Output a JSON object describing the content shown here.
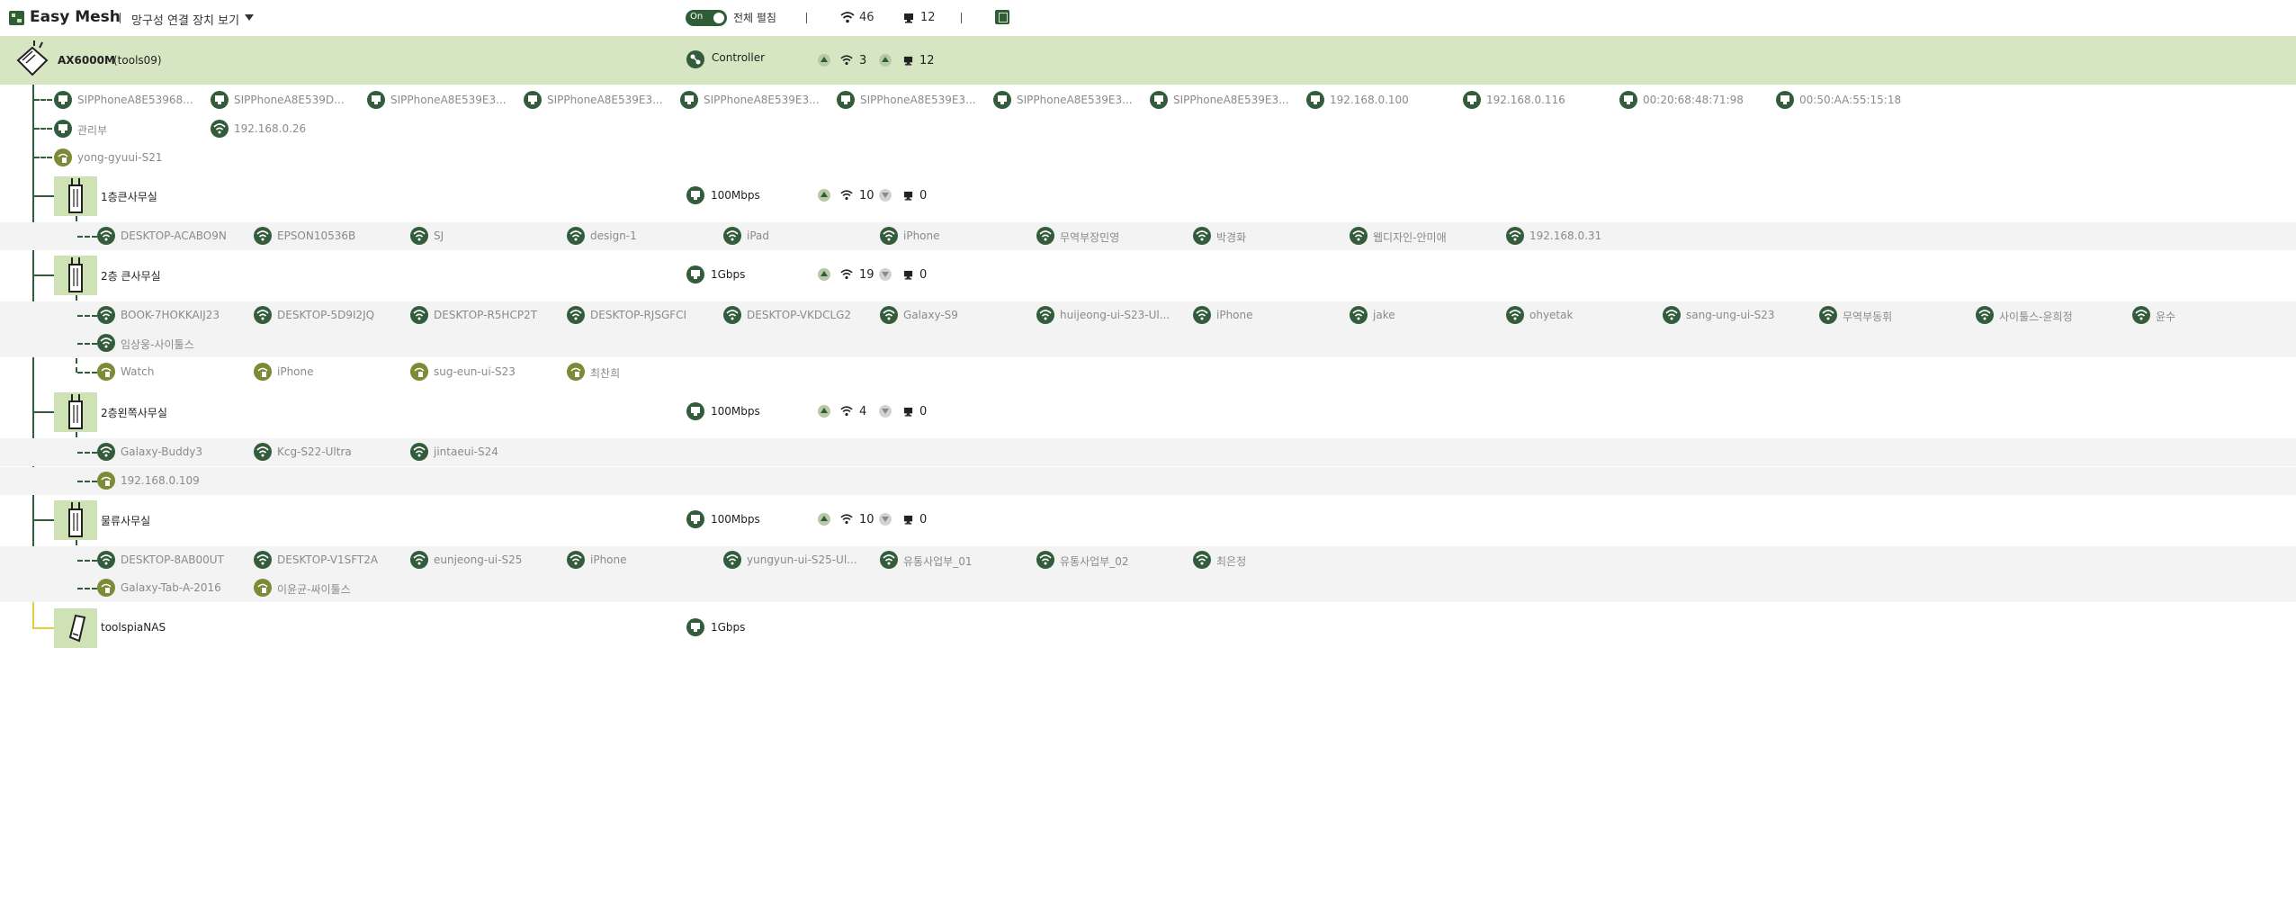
{
  "header": {
    "title": "Easy Mesh",
    "view_menu": "망구성 연결 장치 보기",
    "toggle_state": "On",
    "expand_all": "전체 펼침",
    "wifi_total": "46",
    "wired_total": "12"
  },
  "controller": {
    "name": "AX6000M",
    "name_suffix": "(tools09)",
    "role": "Controller",
    "wifi_count": "3",
    "wired_count": "12"
  },
  "controller_devices": {
    "row1": [
      "SIPPhoneA8E53968...",
      "SIPPhoneA8E539D...",
      "SIPPhoneA8E539E3...",
      "SIPPhoneA8E539E3...",
      "SIPPhoneA8E539E3...",
      "SIPPhoneA8E539E3...",
      "SIPPhoneA8E539E3...",
      "SIPPhoneA8E539E3...",
      "192.168.0.100",
      "192.168.0.116",
      "00:20:68:48:71:98",
      "00:50:AA:55:15:18"
    ],
    "row2": [
      "관리부",
      "192.168.0.26"
    ],
    "row3": [
      "yong-gyuui-S21"
    ]
  },
  "nodes": [
    {
      "name": "1층큰사무실",
      "speed": "100Mbps",
      "wifi": "10",
      "wired": "0",
      "wifi_devices": [
        "DESKTOP-ACABO9N",
        "EPSON10536B",
        "SJ",
        "design-1",
        "iPad",
        "iPhone",
        "무역부장민영",
        "박경화",
        "웹디자인-안미애",
        "192.168.0.31"
      ]
    },
    {
      "name": "2층 큰사무실",
      "speed": "1Gbps",
      "wifi": "19",
      "wired": "0",
      "wifi_devices": [
        "BOOK-7HOKKAIJ23",
        "DESKTOP-5D9I2JQ",
        "DESKTOP-R5HCP2T",
        "DESKTOP-RJSGFCI",
        "DESKTOP-VKDCLG2",
        "Galaxy-S9",
        "huijeong-ui-S23-Ul...",
        "iPhone",
        "jake",
        "ohyetak",
        "sang-ung-ui-S23",
        "무역부동휘",
        "사이툴스-윤희정",
        "윤수"
      ],
      "wifi_devices_2": [
        "임상웅-사이툴스"
      ],
      "mobile_devices": [
        "Watch",
        "iPhone",
        "sug-eun-ui-S23",
        "최찬희"
      ]
    },
    {
      "name": "2층왼쪽사무실",
      "speed": "100Mbps",
      "wifi": "4",
      "wired": "0",
      "wifi_devices": [
        "Galaxy-Buddy3",
        "Kcg-S22-Ultra",
        "jintaeui-S24"
      ],
      "mobile_devices": [
        "192.168.0.109"
      ]
    },
    {
      "name": "물류사무실",
      "speed": "100Mbps",
      "wifi": "10",
      "wired": "0",
      "wifi_devices": [
        "DESKTOP-8AB00UT",
        "DESKTOP-V1SFT2A",
        "eunjeong-ui-S25",
        "iPhone",
        "yungyun-ui-S25-Ul...",
        "유통사업부_01",
        "유통사업부_02",
        "최은정"
      ],
      "mobile_devices": [
        "Galaxy-Tab-A-2016",
        "이윤균-싸이툴스"
      ]
    }
  ],
  "nas": {
    "name": "toolspiaNAS",
    "speed": "1Gbps"
  },
  "colors": {
    "accent": "#2f5d38",
    "row_highlight": "#d6e6c2",
    "node_icon_bg": "#cfe2b6",
    "mobile_icon": "#7b8b36",
    "nas_line": "#e3cf3c"
  }
}
